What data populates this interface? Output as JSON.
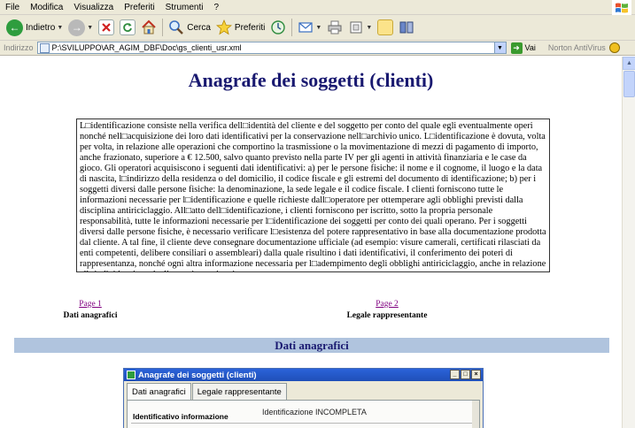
{
  "menu": [
    "File",
    "Modifica",
    "Visualizza",
    "Preferiti",
    "Strumenti",
    "?"
  ],
  "toolbar": {
    "back_label": "Indietro",
    "search_label": "Cerca",
    "favorites_label": "Preferiti"
  },
  "address": {
    "label": "Indirizzo",
    "url": "P:\\SVILUPPO\\AR_AGIM_DBF\\Doc\\gs_clienti_usr.xml",
    "go_label": "Vai",
    "norton_label": "Norton AntiVirus"
  },
  "page": {
    "title": "Anagrafe dei soggetti (clienti)",
    "info_text": "L□identificazione consiste nella verifica dell□identità del cliente e del soggetto per conto del quale egli eventualmente operi nonché nell□acquisizione dei loro dati identificativi per la conservazione nell□archivio unico. L□identificazione è dovuta, volta per volta, in relazione alle operazioni che comportino la trasmissione o la movimentazione di mezzi di pagamento di importo, anche frazionato, superiore a € 12.500, salvo quanto previsto nella parte IV per gli agenti in attività finanziaria e le case da gioco. Gli operatori acquisiscono i seguenti dati identificativi: a) per le persone fisiche: il nome e il cognome, il luogo e la data di nascita, l□indirizzo della residenza o del domicilio, il codice fiscale e gli estremi del documento di identificazione; b) per i soggetti diversi dalle persone fisiche: la denominazione, la sede legale e il codice fiscale. I clienti forniscono tutte le informazioni necessarie per l□identificazione e quelle richieste dall□operatore per ottemperare agli obblighi previsti dalla disciplina antiriciclaggio. All□atto dell□identificazione, i clienti forniscono per iscritto, sotto la propria personale responsabilità, tutte le informazioni necessarie per l□identificazione dei soggetti per conto dei quali operano. Per i soggetti diversi dalle persone fisiche, è necessario verificare l□esistenza del potere rappresentativo in base alla documentazione prodotta dal cliente. A tal fine, il cliente deve consegnare documentazione ufficiale (ad esempio: visure camerali, certificati rilasciati da enti competenti, delibere consiliari o assembleari) dalla quale risultino i dati identificativi, il conferimento dei poteri di rappresentanza, nonché ogni altra informazione necessaria per l□adempimento degli obblighi antiriciclaggio, anche in relazione all□individuazione degli assetti proprietari.",
    "page_links": [
      {
        "link": "Page 1",
        "caption": "Dati anagrafici"
      },
      {
        "link": "Page 2",
        "caption": "Legale rappresentante"
      }
    ],
    "section_title": "Dati anagrafici"
  },
  "subwindow": {
    "title": "Anagrafe dei soggetti (clienti)",
    "tabs": [
      "Dati anagrafici",
      "Legale rappresentante"
    ],
    "field_label": "Identificativo informazione",
    "field_value": "Identificazione INCOMPLETA"
  }
}
